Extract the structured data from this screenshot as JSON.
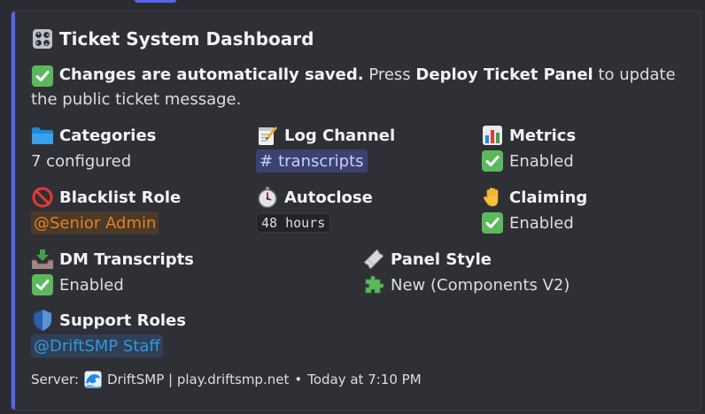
{
  "embed": {
    "title": "Ticket System Dashboard",
    "title_icon": "control-knobs-icon",
    "desc_bold1": "Changes are automatically saved.",
    "desc_text1": " Press ",
    "desc_bold2": "Deploy Ticket Panel",
    "desc_text2": " to update the public ticket message.",
    "accent_color": "#5865f2"
  },
  "fields": {
    "categories": {
      "name": "Categories",
      "value": "7 configured",
      "icon": "folder-icon"
    },
    "log_channel": {
      "name": "Log Channel",
      "value": "transcripts",
      "icon": "memo-icon"
    },
    "metrics": {
      "name": "Metrics",
      "value": "Enabled",
      "icon": "bar-chart-icon"
    },
    "blacklist_role": {
      "name": "Blacklist Role",
      "value": "@Senior Admin",
      "icon": "prohibited-icon"
    },
    "autoclose": {
      "name": "Autoclose",
      "value": "48 hours",
      "icon": "stopwatch-icon"
    },
    "claiming": {
      "name": "Claiming",
      "value": "Enabled",
      "icon": "raised-hand-icon"
    },
    "dm_transcripts": {
      "name": "DM Transcripts",
      "value": "Enabled",
      "icon": "inbox-tray-icon"
    },
    "panel_style": {
      "name": "Panel Style",
      "value": "New (Components V2)",
      "icon": "ticket-icon",
      "value_icon": "puzzle-icon"
    },
    "support_roles": {
      "name": "Support Roles",
      "value": "@DriftSMP Staff",
      "icon": "shield-icon"
    }
  },
  "footer": {
    "prefix": "Server:",
    "server": "DriftSMP | play.driftsmp.net",
    "separator": "•",
    "timestamp": "Today at 7:10 PM"
  }
}
